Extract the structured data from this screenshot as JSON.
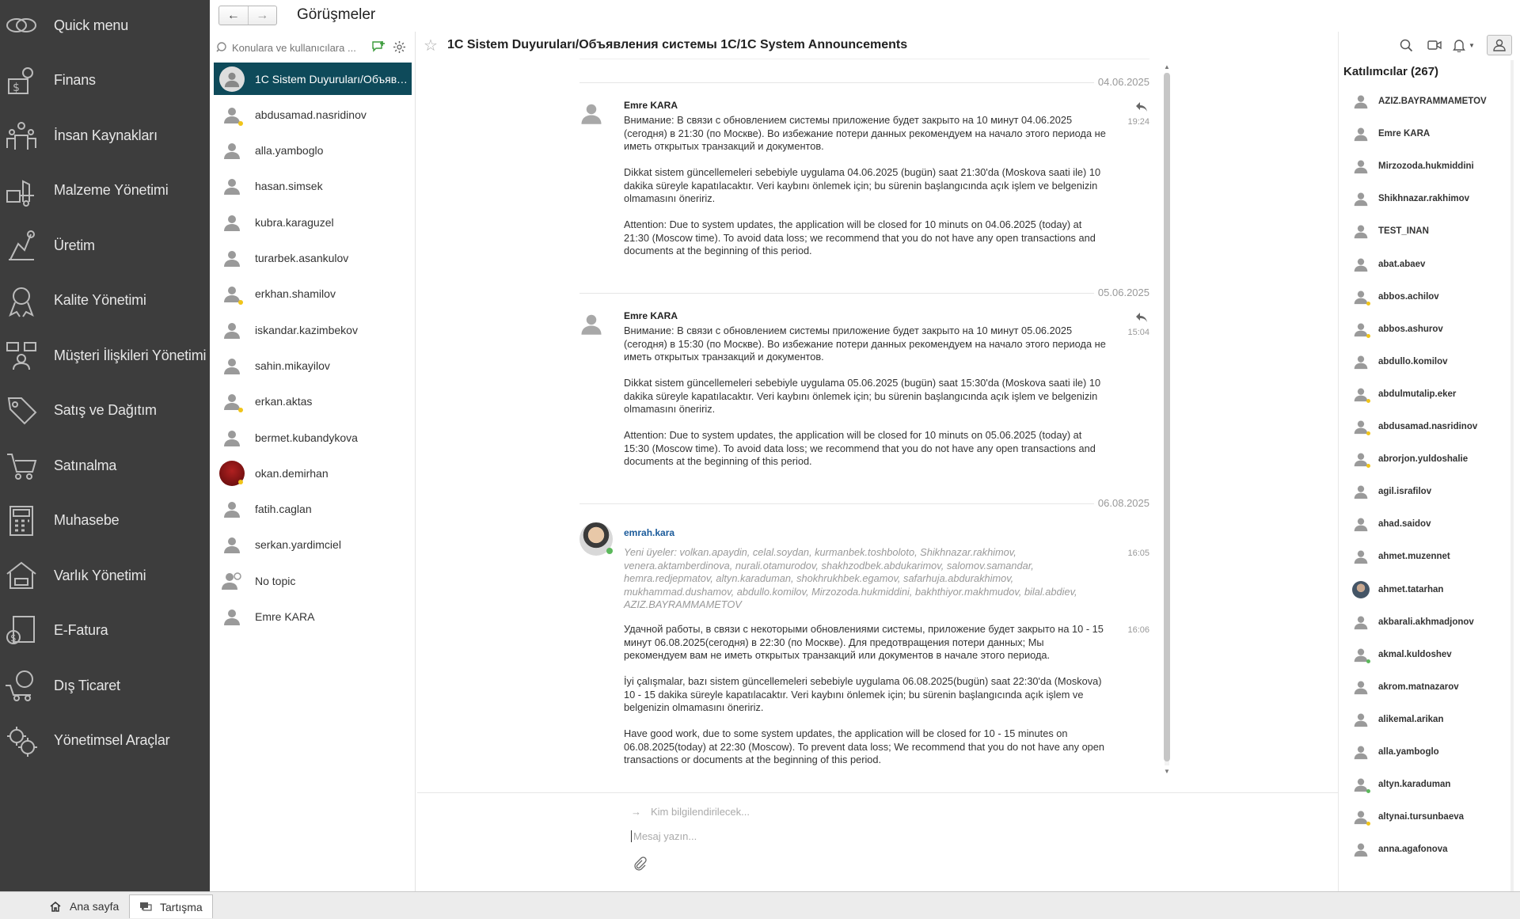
{
  "left_menu": [
    {
      "label": "Quick menu",
      "icon": "quick-menu-icon"
    },
    {
      "label": "Finans",
      "icon": "finance-icon"
    },
    {
      "label": "İnsan Kaynakları",
      "icon": "hr-icon"
    },
    {
      "label": "Malzeme Yönetimi",
      "icon": "material-icon"
    },
    {
      "label": "Üretim",
      "icon": "production-icon"
    },
    {
      "label": "Kalite Yönetimi",
      "icon": "quality-icon"
    },
    {
      "label": "Müşteri İlişkileri Yönetimi",
      "icon": "crm-icon"
    },
    {
      "label": "Satış ve Dağıtım",
      "icon": "sales-icon"
    },
    {
      "label": "Satınalma",
      "icon": "purchase-icon"
    },
    {
      "label": "Muhasebe",
      "icon": "accounting-icon"
    },
    {
      "label": "Varlık Yönetimi",
      "icon": "asset-icon"
    },
    {
      "label": "E-Fatura",
      "icon": "invoice-icon"
    },
    {
      "label": "Dış Ticaret",
      "icon": "foreign-trade-icon"
    },
    {
      "label": "Yönetimsel Araçlar",
      "icon": "tools-icon"
    }
  ],
  "header": {
    "title": "Görüşmeler",
    "back": "←",
    "forward": "→"
  },
  "conversations": {
    "search_placeholder": "Konulara ve kullanıcılara ...",
    "items": [
      {
        "name": "1C Sistem Duyuruları/Объявления системы 1С/1C System Announcements",
        "active": true,
        "status": ""
      },
      {
        "name": "abdusamad.nasridinov",
        "status": "yellow"
      },
      {
        "name": "alla.yamboglo",
        "status": ""
      },
      {
        "name": "hasan.simsek",
        "status": ""
      },
      {
        "name": "kubra.karaguzel",
        "status": ""
      },
      {
        "name": "turarbek.asankulov",
        "status": ""
      },
      {
        "name": "erkhan.shamilov",
        "status": "yellow"
      },
      {
        "name": "iskandar.kazimbekov",
        "status": ""
      },
      {
        "name": "sahin.mikayilov",
        "status": ""
      },
      {
        "name": "erkan.aktas",
        "status": "yellow"
      },
      {
        "name": "bermet.kubandykova",
        "status": ""
      },
      {
        "name": "okan.demirhan",
        "status": "yellow",
        "photo": true
      },
      {
        "name": "fatih.caglan",
        "status": ""
      },
      {
        "name": "serkan.yardimciel",
        "status": ""
      },
      {
        "name": "No topic",
        "status": ""
      },
      {
        "name": "Emre KARA",
        "status": ""
      }
    ]
  },
  "chat": {
    "title": "1C Sistem Duyuruları/Объявления системы 1С/1C System Announcements",
    "dates": [
      "04.06.2025",
      "05.06.2025",
      "06.08.2025"
    ],
    "messages": [
      {
        "author": "Emre KARA",
        "time": "19:24",
        "p1": "Внимание: В связи с обновлением системы приложение будет закрыто на 10 минут 04.06.2025 (сегодня) в 21:30 (по Москве). Во избежание потери данных рекомендуем на начало этого периода не иметь открытых транзакций и документов.",
        "p2": "Dikkat sistem güncellemeleri sebebiyle uygulama 04.06.2025 (bugün) saat 21:30'da (Moskova saati ile) 10 dakika süreyle kapatılacaktır. Veri kaybını önlemek için; bu sürenin başlangıcında açık işlem ve belgenizin olmamasını öneririz.",
        "p3": "Attention: Due to system updates, the application will be closed for 10 minuts on 04.06.2025 (today) at 21:30 (Moscow time). To avoid data loss; we recommend that you do not have any open transactions and documents at the beginning of this period."
      },
      {
        "author": "Emre KARA",
        "time": "15:04",
        "p1": "Внимание: В связи с обновлением системы приложение будет закрыто на 10 минут 05.06.2025 (сегодня) в 15:30 (по Москве). Во избежание потери данных рекомендуем на начало этого периода не иметь открытых транзакций и документов.",
        "p2": "Dikkat sistem güncellemeleri sebebiyle uygulama 05.06.2025 (bugün) saat 15:30'da (Moskova saati ile) 10 dakika süreyle kapatılacaktır. Veri kaybını önlemek için; bu sürenin başlangıcında açık işlem ve belgenizin olmamasını öneririz.",
        "p3": "Attention: Due to system updates, the application will be closed for 10 minuts on 05.06.2025 (today) at 15:30 (Moscow time). To avoid data loss; we recommend that you do not have any open transactions and documents at the beginning of this period."
      },
      {
        "author": "emrah.kara",
        "time1": "16:05",
        "time2": "16:06",
        "system": "Yeni üyeler: volkan.apaydin, celal.soydan, kurmanbek.toshboloto, Shikhnazar.rakhimov, venera.aktamberdinova, nurali.otamurodov, shakhzodbek.abdukarimov, salomov.samandar, hemra.redjepmatov, altyn.karaduman, shokhrukhbek.egamov, safarhuja.abdurakhimov, mukhammad.dushamov, abdullo.komilov, Mirzozoda.hukmiddini, bakhthiyor.makhmudov, bilal.abdiev, AZIZ.BAYRAMMAMETOV",
        "p1": "Удачной работы, в связи с некоторыми обновлениями системы, приложение будет закрыто на 10 - 15 минут 06.08.2025(сегодня) в 22:30 (по Москве). Для предотвращения потери данных; Мы рекомендуем вам не иметь открытых транзакций или документов в начале этого периода.",
        "p2": "İyi çalışmalar, bazı sistem güncellemeleri sebebiyle uygulama 06.08.2025(bugün) saat 22:30'da (Moskova) 10 - 15 dakika süreyle kapatılacaktır. Veri kaybını önlemek için; bu sürenin başlangıcında açık işlem ve belgenizin olmamasını öneririz.",
        "p3": "Have good work, due to some system updates, the application will be closed for 10 - 15 minutes on 06.08.2025(today) at 22:30 (Moscow). To prevent data loss; We recommend that you do not have any open transactions or documents at the beginning of this period."
      }
    ],
    "composer": {
      "to_placeholder": "Kim bilgilendirilecek...",
      "message_placeholder": "Mesaj yazın..."
    }
  },
  "participants": {
    "title": "Katılımcılar (267)",
    "items": [
      {
        "name": "AZIZ.BAYRAMMAMETOV",
        "status": ""
      },
      {
        "name": "Emre KARA",
        "status": ""
      },
      {
        "name": "Mirzozoda.hukmiddini",
        "status": ""
      },
      {
        "name": "Shikhnazar.rakhimov",
        "status": ""
      },
      {
        "name": "TEST_INAN",
        "status": ""
      },
      {
        "name": "abat.abaev",
        "status": ""
      },
      {
        "name": "abbos.achilov",
        "status": "yellow"
      },
      {
        "name": "abbos.ashurov",
        "status": "yellow"
      },
      {
        "name": "abdullo.komilov",
        "status": ""
      },
      {
        "name": "abdulmutalip.eker",
        "status": "yellow"
      },
      {
        "name": "abdusamad.nasridinov",
        "status": "yellow"
      },
      {
        "name": "abrorjon.yuldoshalie",
        "status": "yellow"
      },
      {
        "name": "agil.israfilov",
        "status": ""
      },
      {
        "name": "ahad.saidov",
        "status": ""
      },
      {
        "name": "ahmet.muzennet",
        "status": ""
      },
      {
        "name": "ahmet.tatarhan",
        "status": "",
        "photo": true
      },
      {
        "name": "akbarali.akhmadjonov",
        "status": ""
      },
      {
        "name": "akmal.kuldoshev",
        "status": "green"
      },
      {
        "name": "akrom.matnazarov",
        "status": ""
      },
      {
        "name": "alikemal.arikan",
        "status": ""
      },
      {
        "name": "alla.yamboglo",
        "status": ""
      },
      {
        "name": "altyn.karaduman",
        "status": "green"
      },
      {
        "name": "altynai.tursunbaeva",
        "status": "yellow"
      },
      {
        "name": "anna.agafonova",
        "status": ""
      }
    ]
  },
  "bottom_tabs": [
    {
      "label": "Ana sayfa",
      "icon": "home-icon"
    },
    {
      "label": "Tartışma",
      "icon": "discussion-icon"
    }
  ],
  "colors": {
    "menu_bg": "#3d3d3d",
    "active_conversation": "#0e4a5a",
    "link": "#1a5a9a"
  }
}
